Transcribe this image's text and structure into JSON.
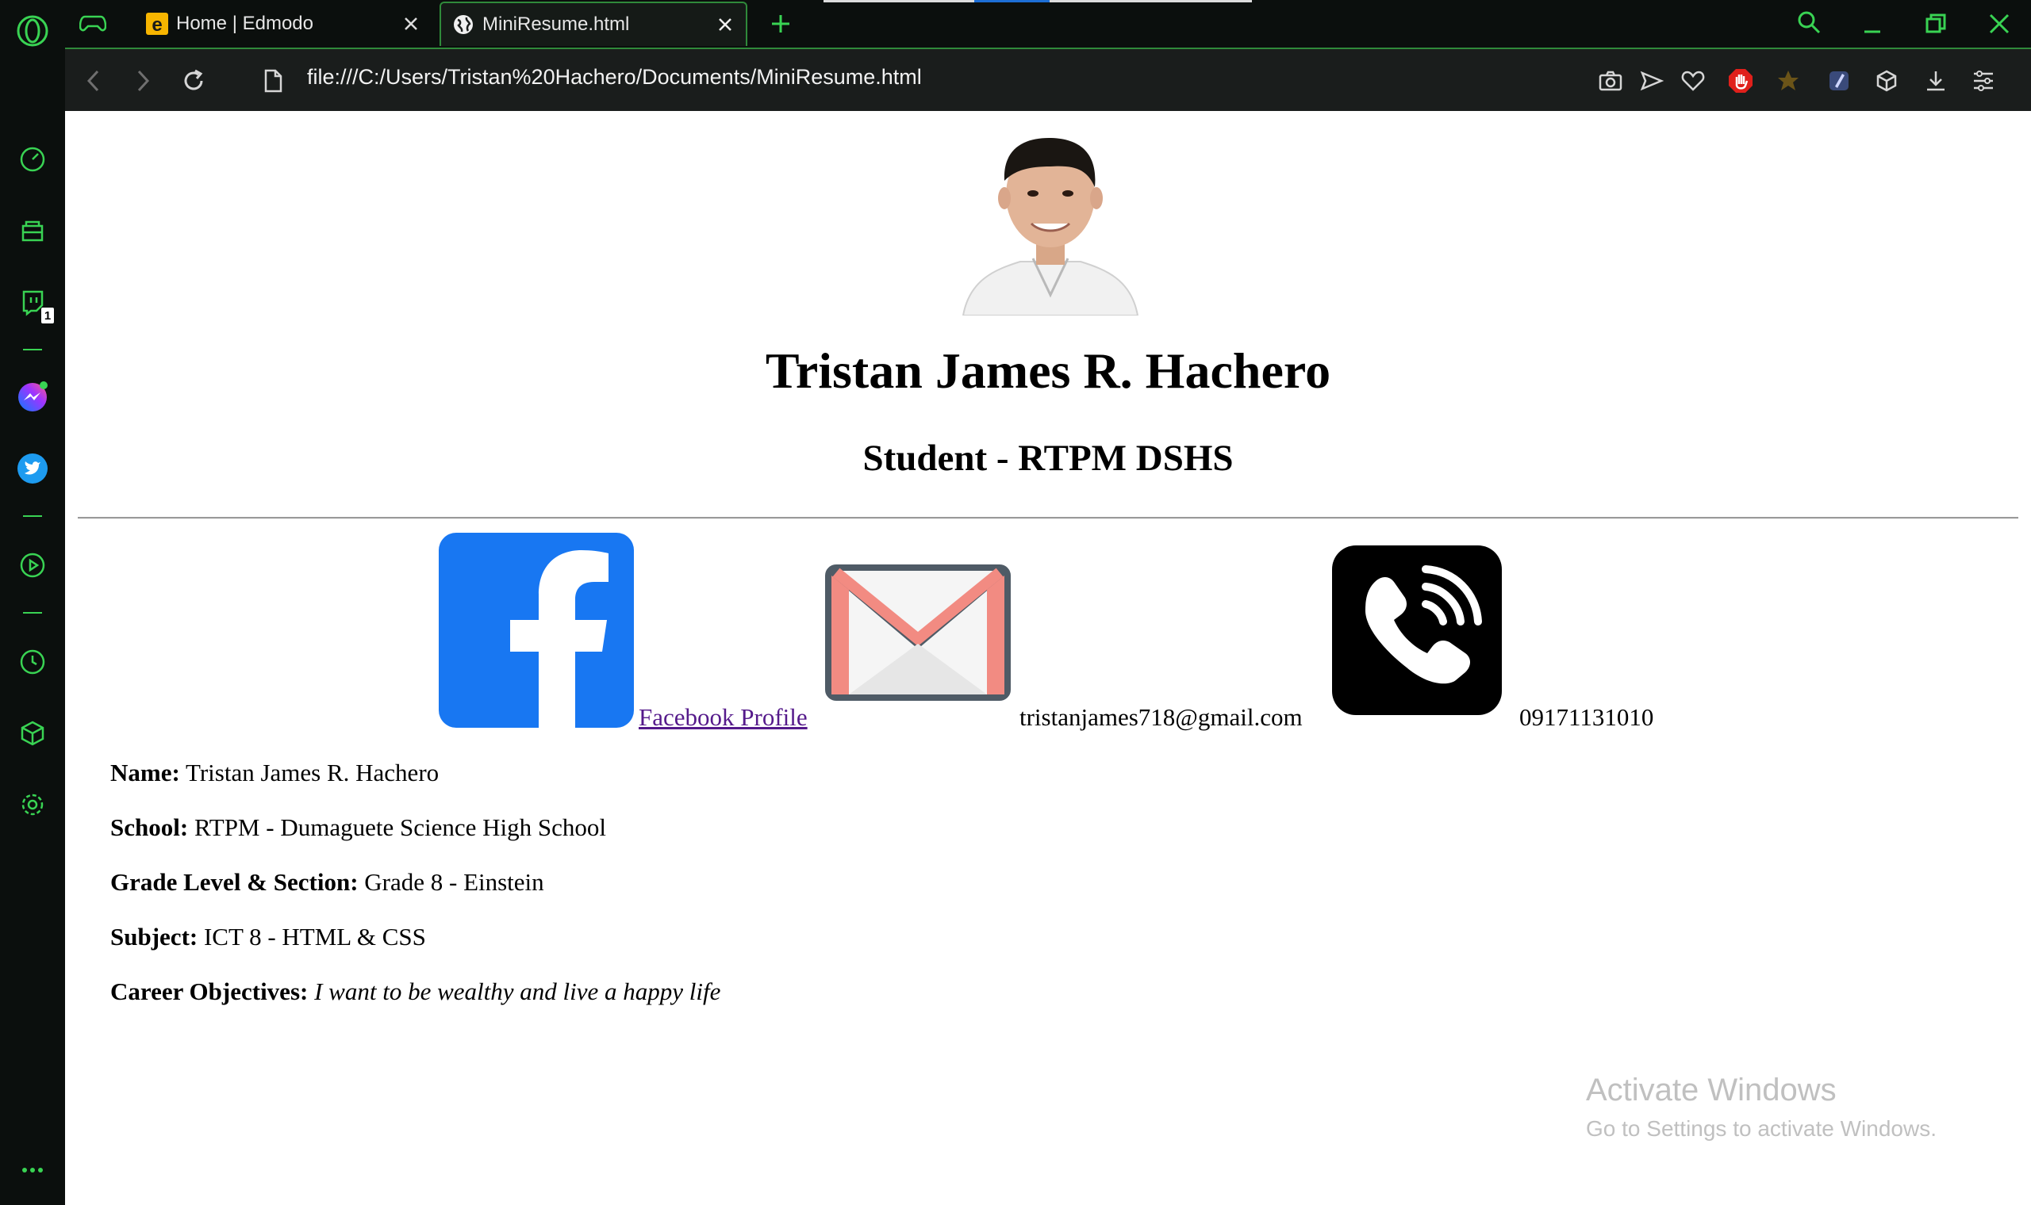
{
  "browser": {
    "tabs": [
      {
        "title": "Home | Edmodo",
        "favicon": "edmodo-icon",
        "active": false
      },
      {
        "title": "MiniResume.html",
        "favicon": "globe-icon",
        "active": true
      }
    ],
    "url": "file:///C:/Users/Tristan%20Hachero/Documents/MiniResume.html",
    "sidebar_badge": "1",
    "accent_color": "#39d353"
  },
  "resume": {
    "name_heading": "Tristan James R. Hachero",
    "role_heading": "Student - RTPM DSHS",
    "contacts": {
      "facebook_label": "Facebook Profile",
      "email": "tristanjames718@gmail.com",
      "phone": "09171131010"
    },
    "info": [
      {
        "label": "Name:",
        "value": "Tristan James R. Hachero"
      },
      {
        "label": "School:",
        "value": "RTPM - Dumaguete Science High School"
      },
      {
        "label": "Grade Level & Section:",
        "value": "Grade 8 - Einstein"
      },
      {
        "label": "Subject:",
        "value": "ICT 8 - HTML & CSS"
      },
      {
        "label": "Career Objectives:",
        "value": "I want to be wealthy and live a happy life"
      }
    ]
  },
  "watermark": {
    "title": "Activate Windows",
    "subtitle": "Go to Settings to activate Windows."
  }
}
